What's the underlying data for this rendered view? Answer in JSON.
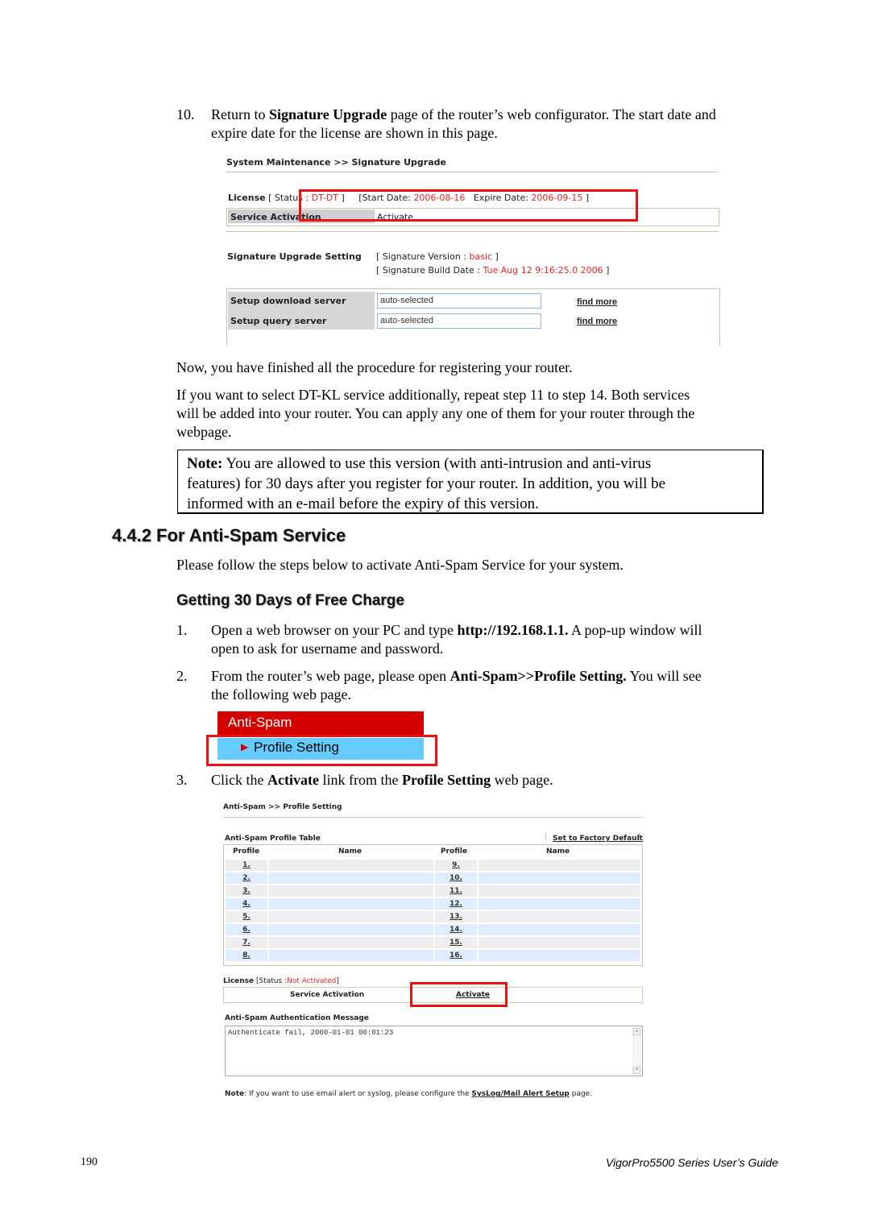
{
  "step10": {
    "number": "10.",
    "pre": "Return to ",
    "bold": "Signature Upgrade",
    "post_line1": " page of the router’s web configurator. The start date and",
    "line2": "expire date for the license are shown in this page."
  },
  "sig_upgrade_screenshot": {
    "breadcrumb": "System Maintenance >> Signature Upgrade",
    "license_label": "License",
    "status_prefix": "[ Status  : ",
    "status_value": "DT-DT",
    "status_suffix": " ]",
    "start_prefix": "[Start Date: ",
    "start_value": "2006-08-16",
    "expire_prefix": "Expire Date: ",
    "expire_value": "2006-09-15",
    "expire_suffix": " ]",
    "service_activation_label": "Service Activation",
    "activate_link": "Activate",
    "setting_label": "Signature Upgrade Setting",
    "version_prefix": "[ Signature Version : ",
    "version_value": "basic",
    "version_suffix": " ]",
    "build_prefix": "[ Signature Build Date : ",
    "build_value": "Tue Aug 12 9:16:25.0 2006",
    "build_suffix": " ]",
    "download_label": "Setup download server",
    "download_value": "auto-selected",
    "query_label": "Setup query server",
    "query_value": "auto-selected",
    "find_more": "find more"
  },
  "para_finished": "Now, you have finished all the procedure for registering your router.",
  "para_dtkl": [
    "If you want to select DT-KL service additionally, repeat step 11 to step 14. Both services",
    "will be added into your router. You can apply any one of them for your router through the",
    "webpage."
  ],
  "note": {
    "label": "Note:",
    "line1": " You are allowed to use this version (with anti-intrusion and anti-virus",
    "line2": "features) for 30 days after you register for your router. In addition, you will be",
    "line3": "informed with an e-mail before the expiry of this version."
  },
  "section_heading": "4.4.2 For Anti-Spam Service",
  "section_intro": "Please follow the steps below to activate Anti-Spam Service for your system.",
  "subheading": "Getting 30 Days of Free Charge",
  "steps": [
    {
      "number": "1.",
      "pre": "Open a web browser on your PC and type ",
      "bold": "http://192.168.1.1.",
      "post": " A pop-up window will",
      "line2": "open to ask for username and password."
    },
    {
      "number": "2.",
      "pre": "From the router’s web page, please open ",
      "bold": "Anti-Spam>>Profile Setting.",
      "post": " You will see",
      "line2": "the following web page."
    },
    {
      "number": "3.",
      "pre": "Click the ",
      "bold": "Activate",
      "mid": " link from the ",
      "bold2": "Profile Setting",
      "post": " web page."
    }
  ],
  "menu_screenshot": {
    "header": "Anti-Spam",
    "item": "Profile Setting",
    "colors": {
      "header_bg": "#d40000",
      "item_bg": "#66ccff",
      "arrow": "#d40000"
    }
  },
  "profile_screenshot": {
    "breadcrumb": "Anti-Spam >> Profile Setting",
    "table_title": "Anti-Spam Profile Table",
    "factory_default": "Set to Factory Default",
    "headers": [
      "Profile",
      "Name",
      "Profile",
      "Name"
    ],
    "rows": [
      {
        "left": "1.",
        "right": "9."
      },
      {
        "left": "2.",
        "right": "10."
      },
      {
        "left": "3.",
        "right": "11."
      },
      {
        "left": "4.",
        "right": "12."
      },
      {
        "left": "5.",
        "right": "13."
      },
      {
        "left": "6.",
        "right": "14."
      },
      {
        "left": "7.",
        "right": "15."
      },
      {
        "left": "8.",
        "right": "16."
      }
    ],
    "license_label": "License",
    "status_prefix": "[Status :",
    "status_value": "Not Activated",
    "status_suffix": "]",
    "service_activation": "Service Activation",
    "activate_link": "Activate",
    "auth_title": "Anti-Spam Authentication Message",
    "auth_message": "Authenticate fail, 2000-01-01 00:01:23",
    "note_label": "Note",
    "note_text": ": If you want to use email alert or syslog, please configure the ",
    "note_link": "SysLog/Mail Alert Setup",
    "note_suffix": " page."
  },
  "footer": {
    "page_number": "190",
    "guide_title": "VigorPro5500 Series User’s Guide"
  },
  "colors": {
    "highlight_red": "#ee1111",
    "status_red": "#ee2222"
  }
}
